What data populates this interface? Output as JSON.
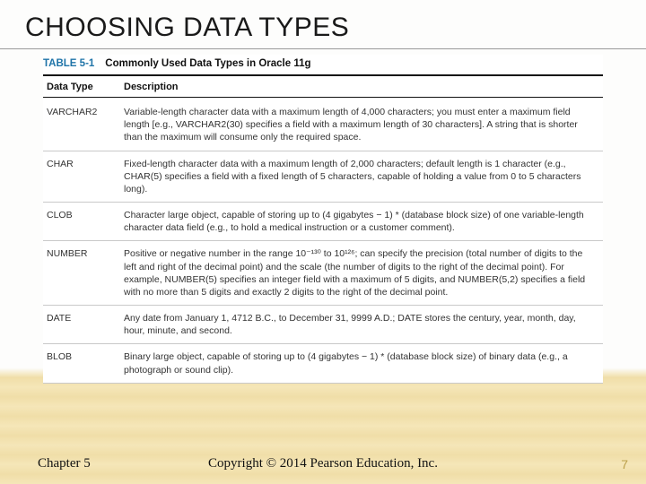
{
  "slide": {
    "title": "CHOOSING DATA TYPES"
  },
  "table": {
    "number": "TABLE 5-1",
    "title": "Commonly Used Data Types in Oracle 11g",
    "headers": {
      "col1": "Data Type",
      "col2": "Description"
    },
    "rows": [
      {
        "type": "VARCHAR2",
        "desc": "Variable-length character data with a maximum length of 4,000 characters; you must enter a maximum field length [e.g., VARCHAR2(30) specifies a field with a maximum length of 30 characters]. A string that is shorter than the maximum will consume only the required space."
      },
      {
        "type": "CHAR",
        "desc": "Fixed-length character data with a maximum length of 2,000 characters; default length is 1 character (e.g., CHAR(5) specifies a field with a fixed length of 5 characters, capable of holding a value from 0 to 5 characters long)."
      },
      {
        "type": "CLOB",
        "desc": "Character large object, capable of storing up to (4 gigabytes − 1) * (database block size) of one variable-length character data field (e.g., to hold a medical instruction or a customer comment)."
      },
      {
        "type": "NUMBER",
        "desc": "Positive or negative number in the range 10⁻¹³⁰ to 10¹²⁶; can specify the precision (total number of digits to the left and right of the decimal point) and the scale (the number of digits to the right of the decimal point). For example, NUMBER(5) specifies an integer field with a maximum of 5 digits, and NUMBER(5,2) specifies a field with no more than 5 digits and exactly 2 digits to the right of the decimal point."
      },
      {
        "type": "DATE",
        "desc": "Any date from January 1, 4712 B.C., to December 31, 9999 A.D.; DATE stores the century, year, month, day, hour, minute, and second."
      },
      {
        "type": "BLOB",
        "desc": "Binary large object, capable of storing up to (4 gigabytes − 1) * (database block size) of binary data (e.g., a photograph or sound clip)."
      }
    ]
  },
  "footer": {
    "chapter": "Chapter 5",
    "copyright": "Copyright © 2014 Pearson Education, Inc.",
    "page": "7"
  }
}
